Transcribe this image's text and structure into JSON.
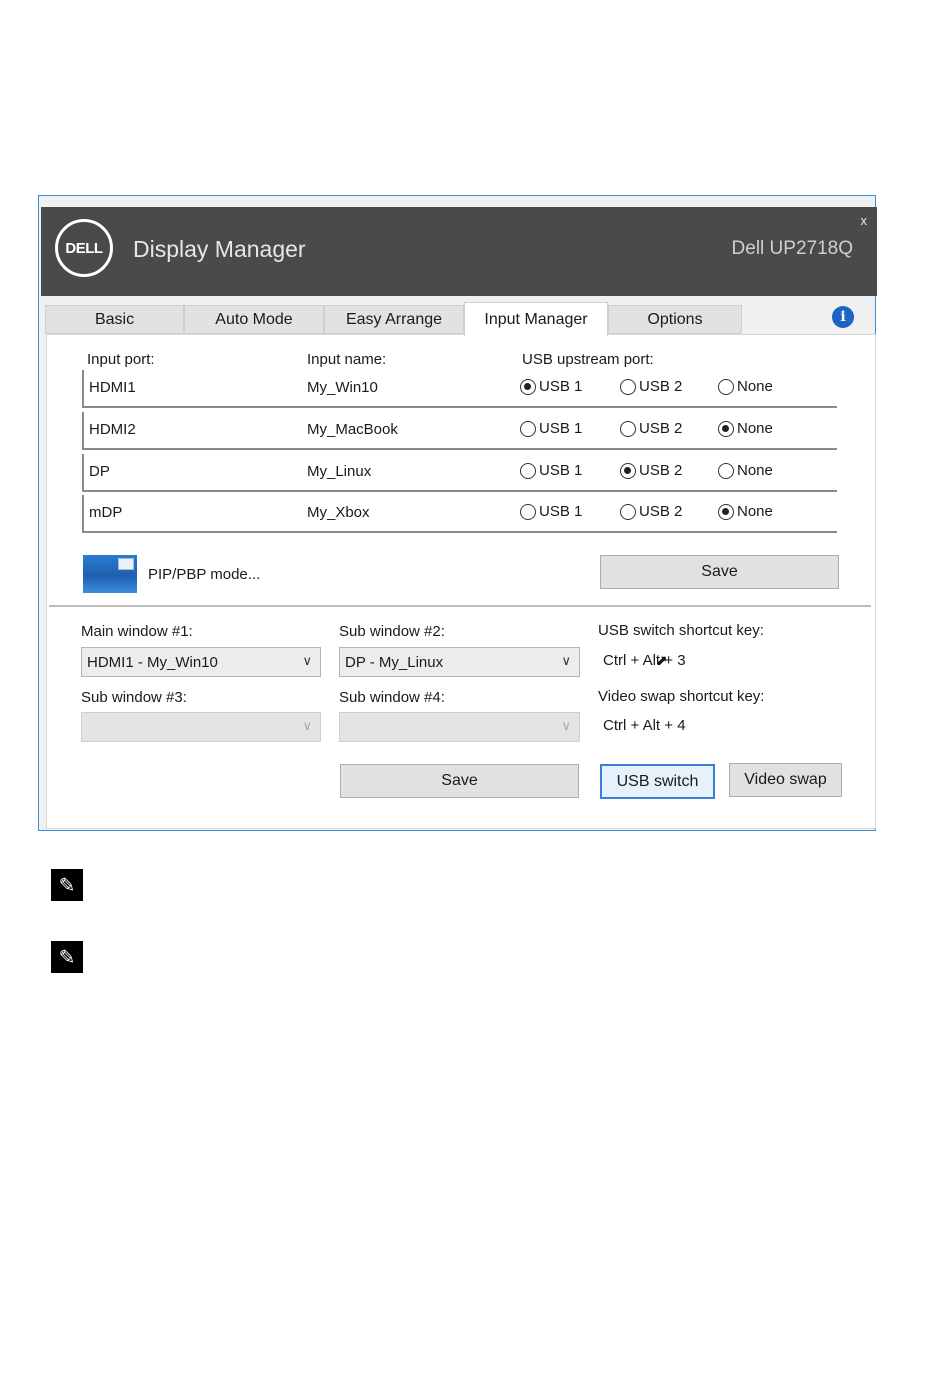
{
  "titlebar": {
    "logo_text": "DELL",
    "app_title": "Display Manager",
    "monitor_model": "Dell UP2718Q",
    "close_label": "x"
  },
  "tabs": [
    {
      "label": "Basic"
    },
    {
      "label": "Auto Mode"
    },
    {
      "label": "Easy Arrange"
    },
    {
      "label": "Input Manager",
      "active": true
    },
    {
      "label": "Options"
    }
  ],
  "info_icon": {
    "glyph": "i",
    "name": "info-icon"
  },
  "input_table": {
    "headers": {
      "port": "Input port:",
      "name": "Input name:",
      "usb": "USB upstream port:"
    },
    "usb_options": [
      "USB 1",
      "USB 2",
      "None"
    ],
    "rows": [
      {
        "port": "HDMI1",
        "name": "My_Win10",
        "selected": "USB 1"
      },
      {
        "port": "HDMI2",
        "name": "My_MacBook",
        "selected": "None"
      },
      {
        "port": "DP",
        "name": "My_Linux",
        "selected": "USB 2"
      },
      {
        "port": "mDP",
        "name": "My_Xbox",
        "selected": "None"
      }
    ]
  },
  "pip": {
    "label": "PIP/PBP mode..."
  },
  "top_save_label": "Save",
  "windows": {
    "main1_label": "Main window #1:",
    "main1_value": "HDMI1 - My_Win10",
    "sub2_label": "Sub window #2:",
    "sub2_value": "DP - My_Linux",
    "sub3_label": "Sub window #3:",
    "sub3_value": "",
    "sub4_label": "Sub window #4:",
    "sub4_value": ""
  },
  "shortcuts": {
    "usb_label": "USB switch shortcut key:",
    "usb_value": "Ctrl + Alt + 3",
    "video_label": "Video swap shortcut key:",
    "video_value": "Ctrl + Alt + 4"
  },
  "buttons": {
    "save_label": "Save",
    "usb_switch_label": "USB switch",
    "video_swap_label": "Video swap"
  },
  "colors": {
    "titlebar": "#4a4a4a",
    "accent_border": "#3b8fd9",
    "info_icon": "#1e63c6"
  }
}
